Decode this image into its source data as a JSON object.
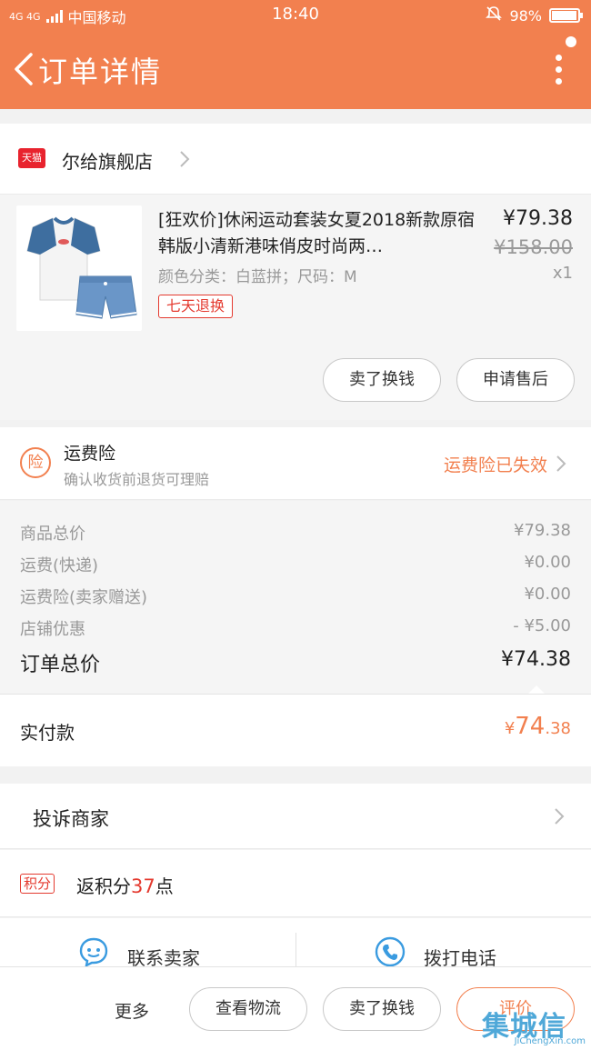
{
  "status_bar": {
    "network": "4G 4G",
    "carrier": "中国移动",
    "time": "18:40",
    "battery": "98%",
    "battery_level": 0.98
  },
  "header": {
    "title": "订单详情"
  },
  "store": {
    "badge": "天猫",
    "name": "尔给旗舰店"
  },
  "product": {
    "title": "[狂欢价]休闲运动套装女夏2018新款原宿韩版小清新港味俏皮时尚两…",
    "spec": "颜色分类：白蓝拼；尺码：M",
    "tag": "七天退换",
    "price": "¥79.38",
    "original_price": "¥158.00",
    "quantity": "x1",
    "buttons": [
      "卖了换钱",
      "申请售后"
    ]
  },
  "insurance": {
    "icon_label": "险",
    "title": "运费险",
    "subtitle": "确认收货前退货可理赔",
    "status": "运费险已失效"
  },
  "summary": {
    "rows": [
      {
        "label": "商品总价",
        "value": "¥79.38"
      },
      {
        "label": "运费(快递)",
        "value": "¥0.00"
      },
      {
        "label": "运费险(卖家赠送)",
        "value": "¥0.00"
      },
      {
        "label": "店铺优惠",
        "value": "- ¥5.00"
      }
    ],
    "total_label": "订单总价",
    "total_value": "¥74.38"
  },
  "paid": {
    "label": "实付款",
    "symbol": "¥",
    "integer": "74",
    "decimal": ".38"
  },
  "complaint": {
    "label": "投诉商家"
  },
  "points": {
    "badge": "积分",
    "prefix": "返积分",
    "amount": "37",
    "suffix": "点"
  },
  "contact": {
    "seller": "联系卖家",
    "phone": "拨打电话"
  },
  "bottom_bar": {
    "more": "更多",
    "logistics": "查看物流",
    "resell": "卖了换钱",
    "review": "评价"
  },
  "watermark": {
    "logo": "集城信",
    "url": "JiChengXin.com"
  },
  "colors": {
    "accent": "#f2804f",
    "tmall_red": "#e8232e",
    "points_red": "#e43a2f"
  }
}
